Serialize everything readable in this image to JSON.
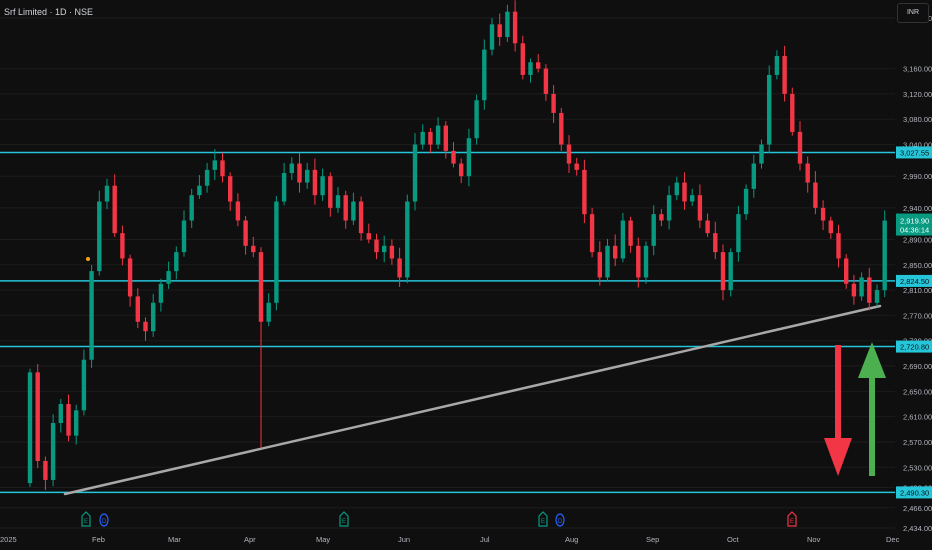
{
  "header": {
    "title": "Srf Limited · 1D · NSE",
    "currency": "INR"
  },
  "colors": {
    "up": "#089981",
    "down": "#f23645",
    "level": "#26c6da",
    "trendline": "#a8a8a8",
    "arrow_down": "#f23645",
    "arrow_up": "#4caf50",
    "marker_e": "#089981",
    "marker_d": "#2962ff",
    "marker_e_red": "#f23645"
  },
  "chart_data": {
    "type": "candlestick",
    "title": "Srf Limited · 1D · NSE",
    "ylabel": "INR",
    "ylim": [
      2420,
      3260
    ],
    "x_tick_labels": [
      "2025",
      "Feb",
      "Mar",
      "Apr",
      "May",
      "Jun",
      "Jul",
      "Aug",
      "Sep",
      "Oct",
      "Nov",
      "Dec"
    ],
    "y_ticks": [
      3240,
      3160,
      3120,
      3080,
      3040,
      2990,
      2940,
      2890,
      2850,
      2810,
      2770,
      2730,
      2690,
      2650,
      2610,
      2570,
      2530,
      2498,
      2466,
      2434
    ],
    "y_tick_labels": [
      "3,240.00",
      "3,160.00",
      "3,120.00",
      "3,080.00",
      "3,040.00",
      "2,990.00",
      "2,940.00",
      "2,890.00",
      "2,850.00",
      "2,810.00",
      "2,770.00",
      "2,730.00",
      "2,690.00",
      "2,650.00",
      "2,610.00",
      "2,570.00",
      "2,530.00",
      "2,498.00",
      "2,466.00",
      "2,434.00"
    ],
    "first_open": 2505,
    "closes": [
      2680,
      2540,
      2510,
      2600,
      2630,
      2580,
      2620,
      2700,
      2840,
      2950,
      2975,
      2900,
      2860,
      2800,
      2760,
      2745,
      2790,
      2820,
      2840,
      2870,
      2920,
      2960,
      2975,
      3000,
      3015,
      2990,
      2950,
      2920,
      2880,
      2870,
      2760,
      2790,
      2950,
      2995,
      3010,
      2980,
      3000,
      2960,
      2990,
      2940,
      2960,
      2920,
      2950,
      2900,
      2890,
      2870,
      2880,
      2860,
      2830,
      2950,
      3040,
      3060,
      3040,
      3070,
      3030,
      3010,
      2990,
      3050,
      3110,
      3190,
      3230,
      3210,
      3250,
      3200,
      3150,
      3170,
      3160,
      3120,
      3090,
      3040,
      3010,
      3000,
      2930,
      2870,
      2830,
      2880,
      2860,
      2920,
      2880,
      2830,
      2880,
      2930,
      2920,
      2960,
      2980,
      2950,
      2960,
      2920,
      2900,
      2870,
      2810,
      2870,
      2930,
      2970,
      3010,
      3040,
      3150,
      3180,
      3120,
      3060,
      3010,
      2980,
      2940,
      2920,
      2900,
      2860,
      2820,
      2800,
      2830,
      2790,
      2810,
      2919.9
    ],
    "levels": [
      {
        "value": 3027.55,
        "label": "3,027.55"
      },
      {
        "value": 2824.5,
        "label": "2,824.50"
      },
      {
        "value": 2720.8,
        "label": "2,720.80"
      },
      {
        "value": 2490.3,
        "label": "2,490.30"
      }
    ],
    "trendline": {
      "from": 2482,
      "to": 2778
    },
    "last_price": {
      "value": 2919.9,
      "label": "2,919.90",
      "countdown": "04:36:14"
    },
    "events": [
      {
        "type": "E",
        "kind": "earnings"
      },
      {
        "type": "D",
        "kind": "dividend"
      },
      {
        "type": "E",
        "kind": "earnings"
      },
      {
        "type": "E",
        "kind": "earnings"
      },
      {
        "type": "D",
        "kind": "dividend"
      },
      {
        "type": "E",
        "kind": "earnings-miss"
      }
    ]
  }
}
